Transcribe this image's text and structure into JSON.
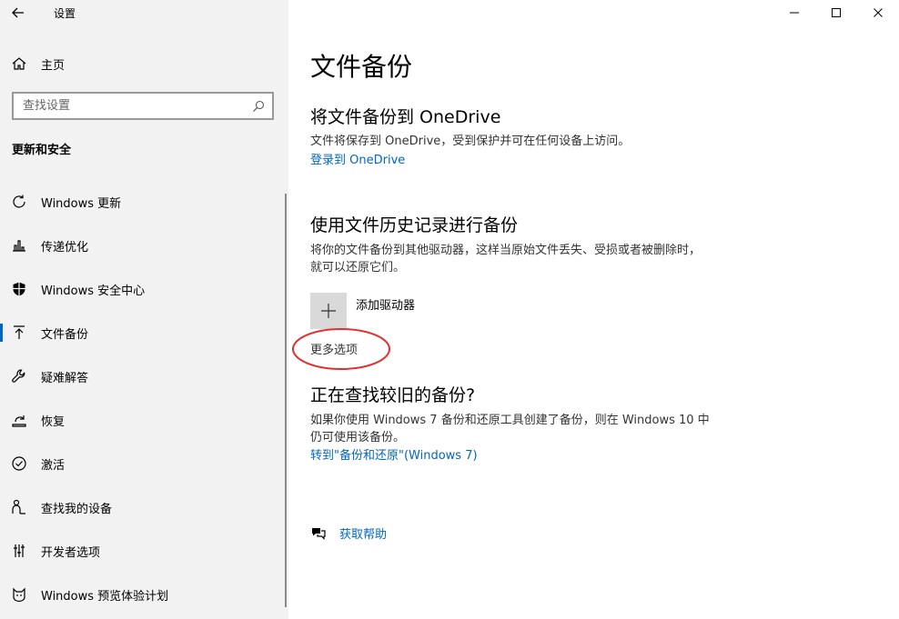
{
  "window": {
    "title": "设置",
    "controls": {
      "minimize": "—",
      "maximize": "☐",
      "close": "✕"
    }
  },
  "sidebar": {
    "home_label": "主页",
    "search_placeholder": "查找设置",
    "section_title": "更新和安全",
    "items": [
      {
        "label": "Windows 更新",
        "icon": "refresh-icon",
        "selected": false
      },
      {
        "label": "传递优化",
        "icon": "delivery-optimization-icon",
        "selected": false
      },
      {
        "label": "Windows 安全中心",
        "icon": "shield-icon",
        "selected": false
      },
      {
        "label": "文件备份",
        "icon": "upload-arrow-icon",
        "selected": true
      },
      {
        "label": "疑难解答",
        "icon": "wrench-icon",
        "selected": false
      },
      {
        "label": "恢复",
        "icon": "recovery-icon",
        "selected": false
      },
      {
        "label": "激活",
        "icon": "check-circle-icon",
        "selected": false
      },
      {
        "label": "查找我的设备",
        "icon": "person-location-icon",
        "selected": false
      },
      {
        "label": "开发者选项",
        "icon": "developer-icon",
        "selected": false
      },
      {
        "label": "Windows 预览体验计划",
        "icon": "insider-cat-icon",
        "selected": false
      }
    ]
  },
  "main": {
    "page_title": "文件备份",
    "onedrive": {
      "heading": "将文件备份到 OneDrive",
      "description": "文件将保存到 OneDrive，受到保护并可在任何设备上访问。",
      "link": "登录到 OneDrive"
    },
    "file_history": {
      "heading": "使用文件历史记录进行备份",
      "description": "将你的文件备份到其他驱动器，这样当原始文件丢失、受损或者被删除时，就可以还原它们。",
      "add_drive_label": "添加驱动器",
      "more_options": "更多选项"
    },
    "older_backup": {
      "heading": "正在查找较旧的备份?",
      "description": "如果你使用 Windows 7 备份和还原工具创建了备份，则在 Windows 10 中仍可使用该备份。",
      "link": "转到\"备份和还原\"(Windows 7)"
    },
    "help": {
      "label": "获取帮助"
    }
  },
  "colors": {
    "accent": "#0067c0",
    "annotation": "#e03030",
    "sidebar_bg": "#f2f2f2"
  }
}
